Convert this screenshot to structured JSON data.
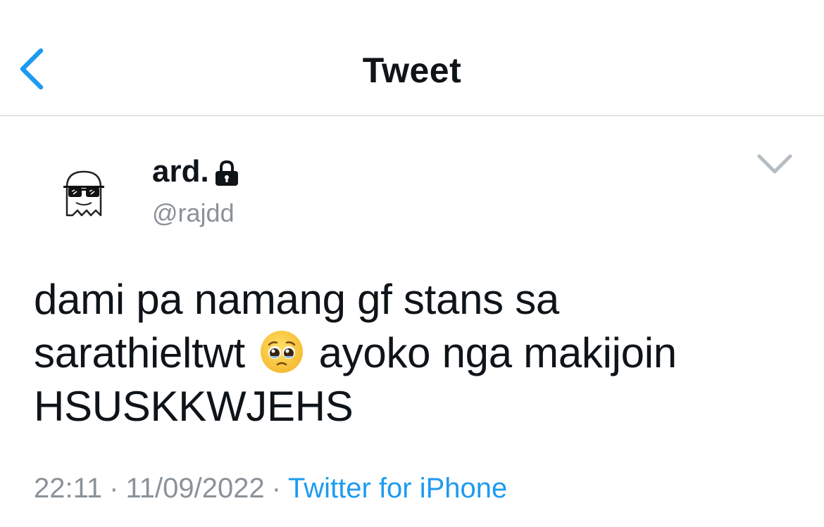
{
  "header": {
    "title": "Tweet",
    "back_icon": "chevron-left-icon",
    "accent_color": "#1d9bf0"
  },
  "tweet": {
    "author": {
      "display_name": "ard.",
      "handle": "@rajdd",
      "protected_icon": "lock-icon",
      "avatar_icon": "ghost-with-sunglasses-icon"
    },
    "more_icon": "chevron-down-icon",
    "text_lines": {
      "line1": "dami pa namang gf stans sa",
      "line2_before": "sarathieltwt",
      "line2_emoji": "pleading-face-emoji",
      "line2_after": "ayoko nga makijoin",
      "line3": "HSUSKKWJEHS"
    },
    "time": "22:11",
    "separator": "·",
    "date": "11/09/2022",
    "source": "Twitter for iPhone"
  }
}
